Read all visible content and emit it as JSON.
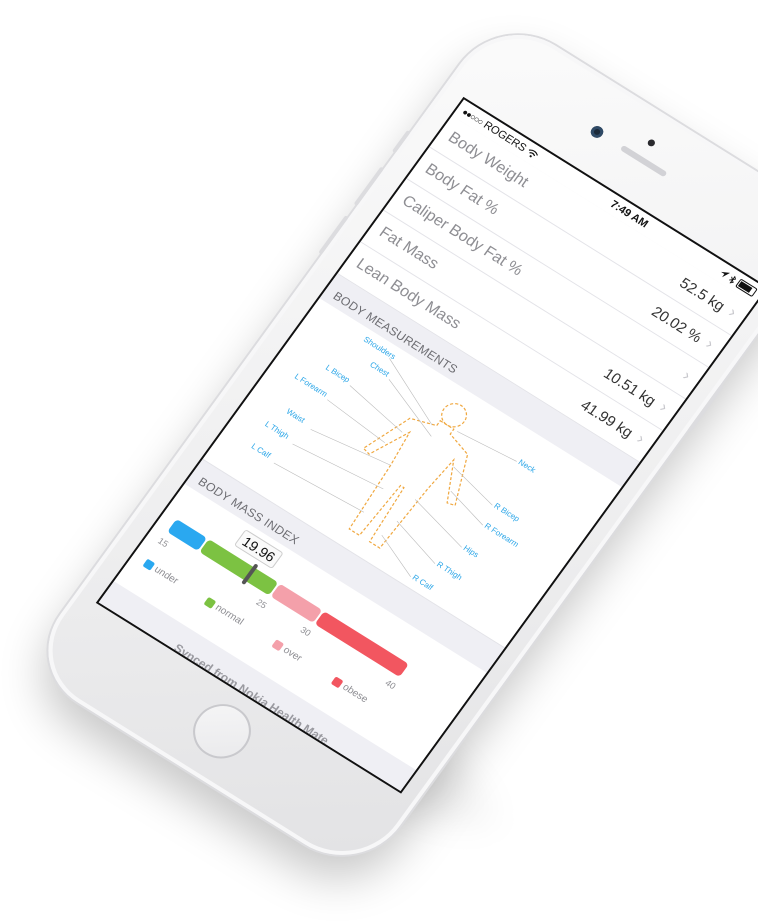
{
  "status_bar": {
    "carrier": "ROGERS",
    "time": "7:49 AM",
    "signal_dots": "●●○○○"
  },
  "metrics": [
    {
      "label": "Body Weight",
      "value": "52.5 kg"
    },
    {
      "label": "Body Fat %",
      "value": "20.02 %"
    },
    {
      "label": "Caliper Body Fat %",
      "value": ""
    },
    {
      "label": "Fat Mass",
      "value": "10.51 kg"
    },
    {
      "label": "Lean Body Mass",
      "value": "41.99 kg"
    }
  ],
  "body_measurements": {
    "header": "BODY MEASUREMENTS",
    "labels": {
      "shoulders": "Shoulders",
      "chest": "Chest",
      "l_bicep": "L Bicep",
      "l_forearm": "L Forearm",
      "neck": "Neck",
      "waist": "Waist",
      "r_bicep": "R Bicep",
      "r_forearm": "R Forearm",
      "l_thigh": "L Thigh",
      "hips": "Hips",
      "l_calf": "L Calf",
      "r_thigh": "R Thigh",
      "r_calf": "R Calf"
    }
  },
  "bmi": {
    "header": "BODY MASS INDEX",
    "value": "19.96",
    "ticks": [
      "15",
      "25",
      "30",
      "40"
    ],
    "legend": {
      "under": "under",
      "normal": "normal",
      "over": "over",
      "obese": "obese"
    },
    "colors": {
      "under": "#2aa8f0",
      "normal": "#7cc242",
      "over": "#f4a0aa",
      "obese": "#f25660"
    }
  },
  "sync": {
    "label": "Synced from Nokia Health Mate"
  },
  "icons": {
    "wifi": "wifi-icon",
    "bluetooth": "bluetooth-icon",
    "battery": "battery-icon",
    "heart": "nokia-health-heart-icon"
  }
}
